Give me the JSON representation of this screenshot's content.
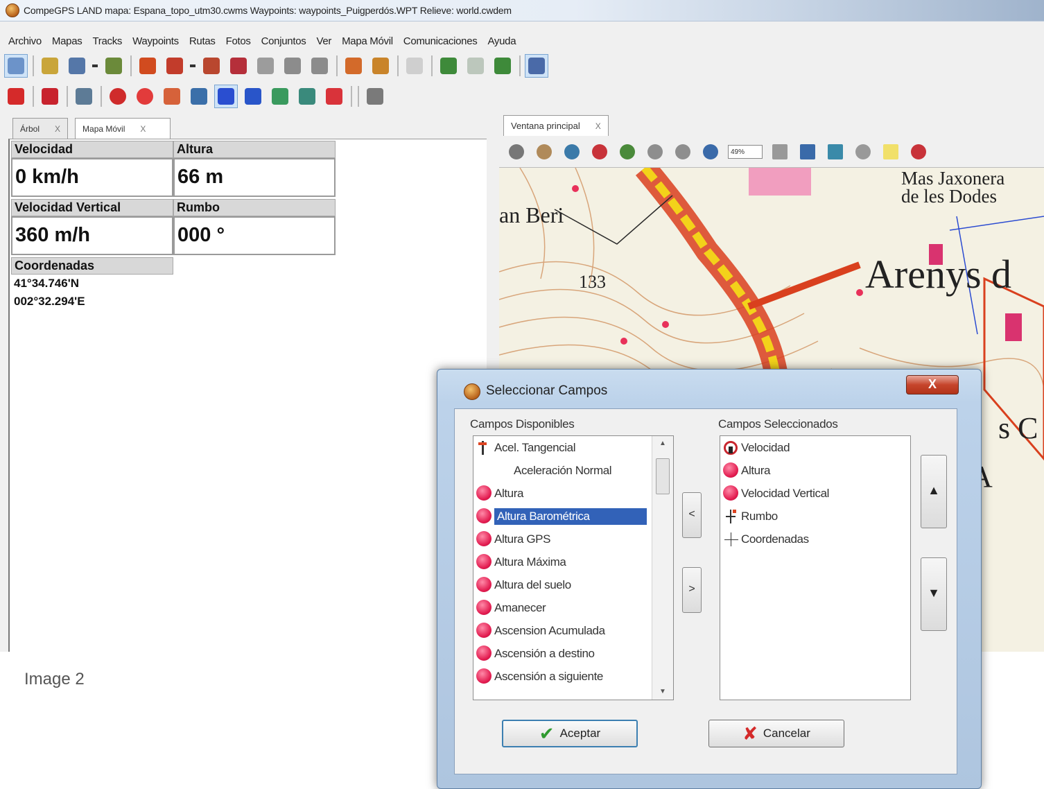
{
  "window": {
    "title": "CompeGPS LAND mapa: Espana_topo_utm30.cwms Waypoints: waypoints_Puigperdós.WPT Relieve: world.cwdem"
  },
  "menu": [
    "Archivo",
    "Mapas",
    "Tracks",
    "Waypoints",
    "Rutas",
    "Fotos",
    "Conjuntos",
    "Ver",
    "Mapa Móvil",
    "Comunicaciones",
    "Ayuda"
  ],
  "left_tabs": {
    "tree": "Árbol",
    "mobile_map": "Mapa Móvil",
    "close": "X"
  },
  "fields": {
    "speed": {
      "label": "Velocidad",
      "value": "0 km/h"
    },
    "height": {
      "label": "Altura",
      "value": "66 m"
    },
    "vertical_speed": {
      "label": "Velocidad Vertical",
      "value": "360 m/h"
    },
    "heading": {
      "label": "Rumbo",
      "value": "000 °"
    },
    "coordinates": {
      "label": "Coordenadas",
      "lat": "41°34.746'N",
      "lon": "002°32.294'E"
    }
  },
  "map": {
    "tab": "Ventana principal",
    "close": "X",
    "zoom": "49%",
    "labels": {
      "place1": "an Beri",
      "elevation": "133",
      "town": "Arenys d",
      "masia_line1": "Mas Jaxonera",
      "masia_line2": "de les Dodes",
      "partial_s": "s C",
      "partial_a": "A"
    }
  },
  "caption": "Image 2",
  "dialog": {
    "title": "Seleccionar Campos",
    "close": "X",
    "available_label": "Campos Disponibles",
    "selected_label": "Campos Seleccionados",
    "available": [
      {
        "label": "Acel. Tangencial",
        "icon": "tangential-icon"
      },
      {
        "label": "Aceleración Normal",
        "icon": "none"
      },
      {
        "label": "Altura",
        "icon": "red-ball-icon"
      },
      {
        "label": "Altura Barométrica",
        "icon": "red-ball-icon",
        "selected": true
      },
      {
        "label": "Altura GPS",
        "icon": "red-ball-icon"
      },
      {
        "label": "Altura Máxima",
        "icon": "red-ball-icon"
      },
      {
        "label": "Altura del suelo",
        "icon": "red-ball-icon"
      },
      {
        "label": "Amanecer",
        "icon": "red-ball-icon"
      },
      {
        "label": "Ascension Acumulada",
        "icon": "red-ball-icon"
      },
      {
        "label": "Ascensión a destino",
        "icon": "red-ball-icon"
      },
      {
        "label": "Ascensión a siguiente",
        "icon": "red-ball-icon"
      }
    ],
    "selected": [
      {
        "label": "Velocidad",
        "icon": "speedometer-icon"
      },
      {
        "label": "Altura",
        "icon": "red-ball-icon"
      },
      {
        "label": "Velocidad Vertical",
        "icon": "red-ball-icon"
      },
      {
        "label": "Rumbo",
        "icon": "compass-icon"
      },
      {
        "label": "Coordenadas",
        "icon": "crosshair-icon"
      }
    ],
    "remove_btn": "<",
    "add_btn": ">",
    "up_btn": "▲",
    "down_btn": "▼",
    "accept": "Aceptar",
    "cancel": "Cancelar"
  },
  "colors": {
    "selection": "#3262b8",
    "accent_red": "#e21b4f"
  }
}
